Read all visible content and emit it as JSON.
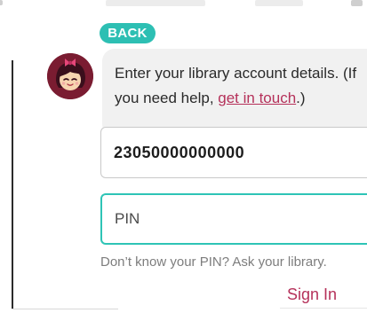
{
  "back_button": {
    "label": "BACK"
  },
  "message": {
    "text_before": "Enter your library account details. (If you need help, ",
    "link_text": "get in touch",
    "text_after": ".)"
  },
  "form": {
    "card_number": {
      "value": "23050000000000"
    },
    "pin": {
      "value": "",
      "placeholder": "PIN"
    },
    "help_text": "Don’t know your PIN? Ask your library."
  },
  "sign_in_button": {
    "label": "Sign In"
  },
  "colors": {
    "accent_teal": "#2dbfb3",
    "link_red": "#b5315a",
    "avatar_bg": "#7a1c31"
  }
}
